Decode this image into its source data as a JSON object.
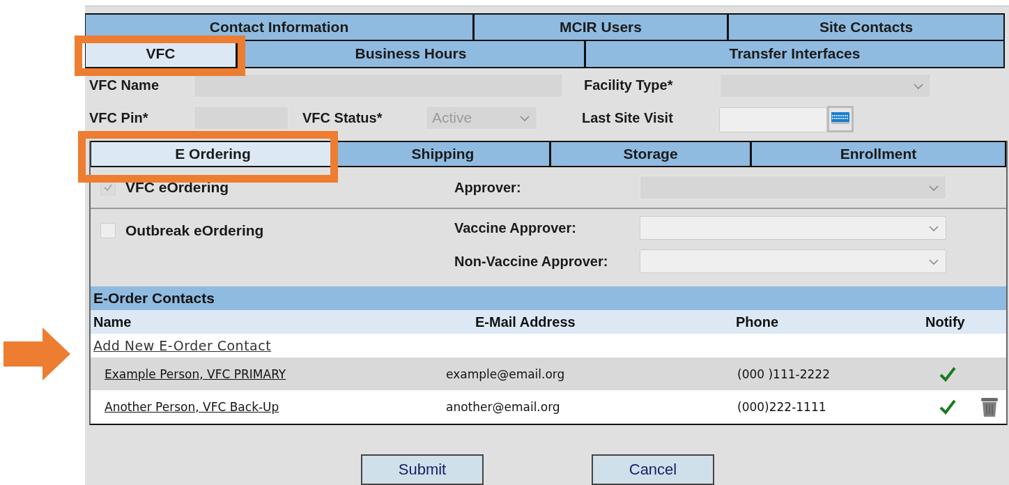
{
  "tab_rows": [
    [
      {
        "label": "Contact Information",
        "selected": false
      },
      {
        "label": "MCIR Users",
        "selected": false
      },
      {
        "label": "Site Contacts",
        "selected": false
      }
    ],
    [
      {
        "label": "VFC",
        "selected": true,
        "highlighted": true
      },
      {
        "label": "Business Hours",
        "selected": false,
        "highlighted": false
      },
      {
        "label": "Transfer Interfaces",
        "selected": false,
        "highlighted": false
      }
    ]
  ],
  "form": {
    "vfc_name": {
      "label": "VFC Name",
      "disabled": true
    },
    "facility_type": {
      "label": "Facility Type*",
      "disabled": true
    },
    "vfc_pin": {
      "label": "VFC Pin*",
      "disabled": true
    },
    "vfc_status": {
      "label": "VFC Status*",
      "value": "Active",
      "disabled": true
    },
    "last_site_visit": {
      "label": "Last Site Visit",
      "disabled": false
    }
  },
  "subtabs": [
    {
      "label": "E Ordering",
      "selected": true,
      "highlighted": true
    },
    {
      "label": "Shipping",
      "selected": false,
      "highlighted": false
    },
    {
      "label": "Storage",
      "selected": false,
      "highlighted": false
    },
    {
      "label": "Enrollment",
      "selected": false,
      "highlighted": false
    }
  ],
  "eordering": {
    "options": [
      {
        "label": "VFC eOrdering",
        "checked": true,
        "disabled": true
      },
      {
        "label": "Outbreak eOrdering",
        "checked": false,
        "disabled": false
      }
    ],
    "approvers": [
      {
        "label": "Approver:",
        "disabled": true
      },
      {
        "label": "Vaccine Approver:",
        "disabled": false
      },
      {
        "label": "Non-Vaccine Approver:",
        "disabled": false
      }
    ]
  },
  "contacts": {
    "title": "E-Order Contacts",
    "columns": [
      "Name",
      "E-Mail Address",
      "Phone",
      "Notify"
    ],
    "add_link": "Add New E-Order Contact",
    "rows": [
      {
        "name": "Example Person, VFC PRIMARY",
        "email": "example@email.org",
        "phone": "(000 )111-2222",
        "notify": true,
        "deletable": false
      },
      {
        "name": "Another Person, VFC Back-Up",
        "email": "another@email.org",
        "phone": "(000)222-1111",
        "notify": true,
        "deletable": true
      }
    ]
  },
  "buttons": [
    "Submit",
    "Cancel"
  ]
}
